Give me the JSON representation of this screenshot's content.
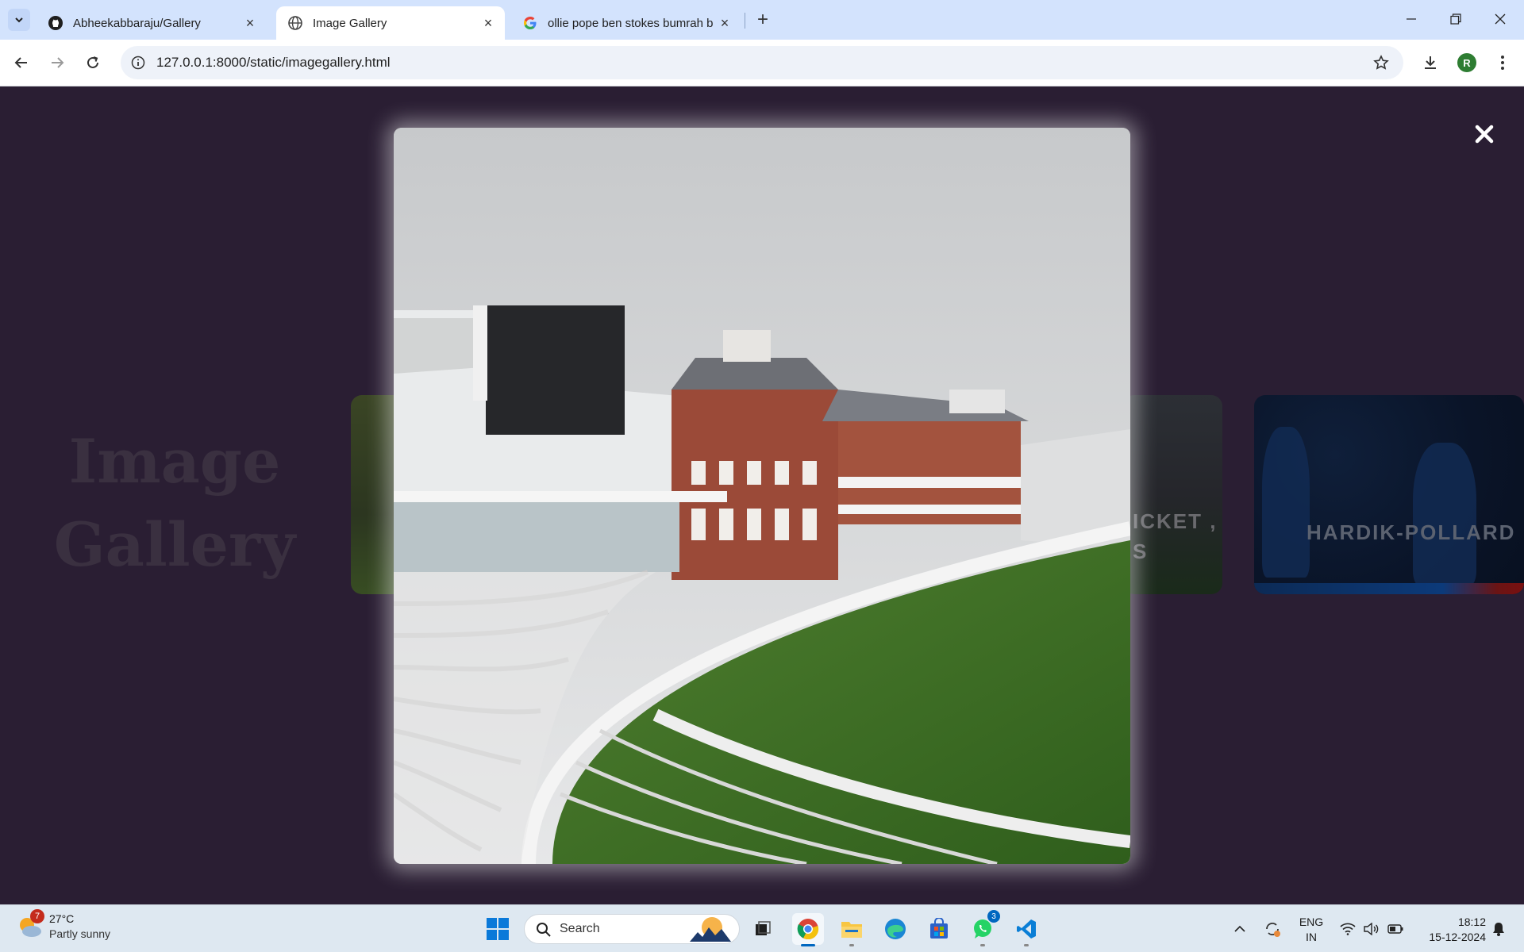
{
  "browser": {
    "tabs": [
      {
        "title": "Abheekabbaraju/Gallery",
        "icon": "github-icon",
        "active": false
      },
      {
        "title": "Image Gallery",
        "icon": "globe-icon",
        "active": true
      },
      {
        "title": "ollie pope ben stokes bumrah b",
        "icon": "google-icon",
        "active": false
      }
    ],
    "url": "127.0.0.1:8000/static/imagegallery.html",
    "profile_initial": "R"
  },
  "page": {
    "title_line1": "Image",
    "title_line2": "Gallery",
    "cards": [
      {
        "label_line1": "ICKET ,",
        "label_line2": "S"
      },
      {
        "label": "HARDIK-POLLARD"
      }
    ],
    "lightbox_image": "cricket-stadium-photo"
  },
  "taskbar": {
    "weather": {
      "temp": "27°C",
      "condition": "Partly sunny",
      "badge": "7"
    },
    "search_label": "Search",
    "whatsapp_badge": "3",
    "language": {
      "line1": "ENG",
      "line2": "IN"
    },
    "clock": {
      "time": "18:12",
      "date": "15-12-2024"
    }
  },
  "colors": {
    "page_bg": "#2a1e33",
    "tabstrip_bg": "#d3e3fd",
    "taskbar_bg": "#dee8f1",
    "accent": "#0067c0"
  }
}
